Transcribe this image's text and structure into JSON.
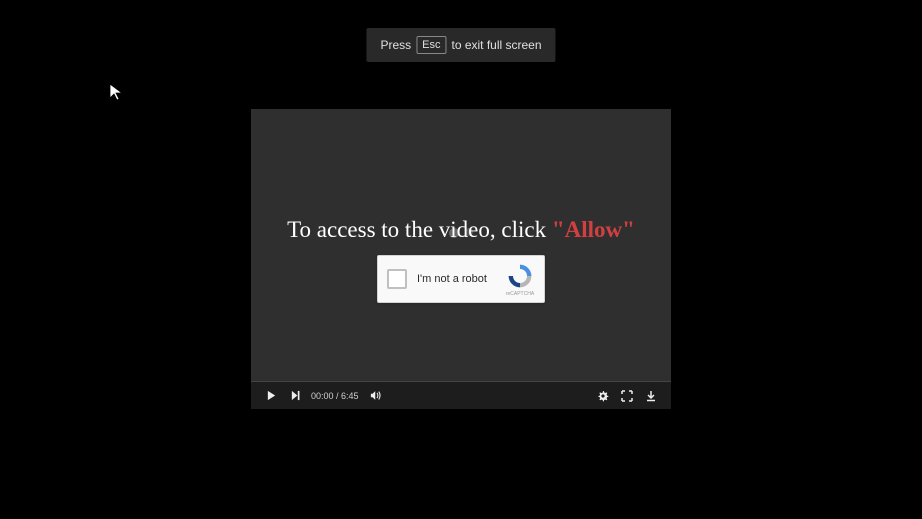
{
  "hint": {
    "pre": "Press",
    "key": "Esc",
    "post": "to exit full screen"
  },
  "overlay": {
    "message_prefix": "To access to the video, click ",
    "allow_word": "\"Allow\""
  },
  "captcha": {
    "label": "I'm not a robot",
    "brand": "reCAPTCHA"
  },
  "controls": {
    "time_current": "00:00",
    "time_separator": " / ",
    "time_duration": "6:45"
  },
  "colors": {
    "accent_red": "#d04040",
    "captcha_blue": "#4a90e2"
  }
}
